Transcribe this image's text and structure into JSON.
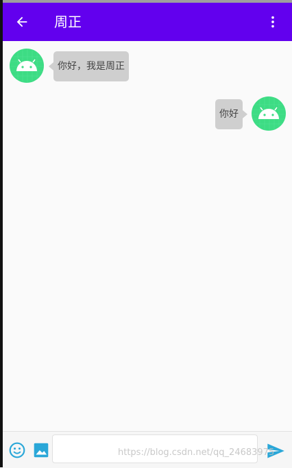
{
  "app_bar": {
    "title": "周正",
    "back_icon": "arrow-back-icon",
    "menu_icon": "more-vert-icon",
    "background": "#6200ee"
  },
  "messages": [
    {
      "side": "left",
      "text": "你好，我是周正",
      "avatar_icon": "android-icon"
    },
    {
      "side": "right",
      "text": "你好",
      "avatar_icon": "android-icon"
    }
  ],
  "input_bar": {
    "emoji_icon": "emoji-icon",
    "image_icon": "image-icon",
    "send_icon": "send-icon",
    "message_value": "",
    "accent": "#2aa7d8"
  },
  "watermark": "https://blog.csdn.net/qq_24683975"
}
